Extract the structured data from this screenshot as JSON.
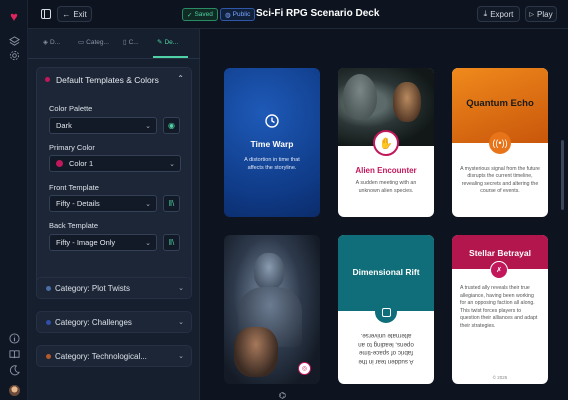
{
  "app": {
    "exit_label": "Exit",
    "title": "Sci-Fi RPG Scenario Deck",
    "saved_label": "Saved",
    "public_label": "Public",
    "export_label": "Export",
    "play_label": "Play"
  },
  "tabs": [
    "D...",
    "Categ...",
    "C...",
    "De..."
  ],
  "panel": {
    "title": "Default Templates & Colors",
    "palette_label": "Color Palette",
    "palette_value": "Dark",
    "primary_label": "Primary Color",
    "primary_value": "Color 1",
    "primary_color": "#c2185b",
    "front_label": "Front Template",
    "front_value": "Fifty - Details",
    "back_label": "Back Template",
    "back_value": "Fifty - Image Only"
  },
  "categories": [
    {
      "label": "Category: Plot Twists",
      "color": "#4a6fa5"
    },
    {
      "label": "Category: Challenges",
      "color": "#2f4fa8"
    },
    {
      "label": "Category: Technological...",
      "color": "#b35a2a"
    }
  ],
  "cards": {
    "time_warp": {
      "title": "Time Warp",
      "text": "A distortion in time that affects the storyline."
    },
    "alien": {
      "title": "Alien Encounter",
      "text": "A sudden meeting with an unknown alien species."
    },
    "quantum": {
      "title": "Quantum Echo",
      "text": "A mysterious signal from the future disrupts the current timeline, revealing secrets and altering the course of events."
    },
    "rift": {
      "title": "Dimensional Rift",
      "text": "A sudden tear in the fabric of space-time opens, leading to an alternate universe."
    },
    "betrayal": {
      "title": "Stellar Betrayal",
      "text": "A trusted ally reveals their true allegiance, having been working for an opposing faction all along. This twist forces players to question their alliances and adapt their strategies.",
      "footer": "© 2025"
    }
  }
}
